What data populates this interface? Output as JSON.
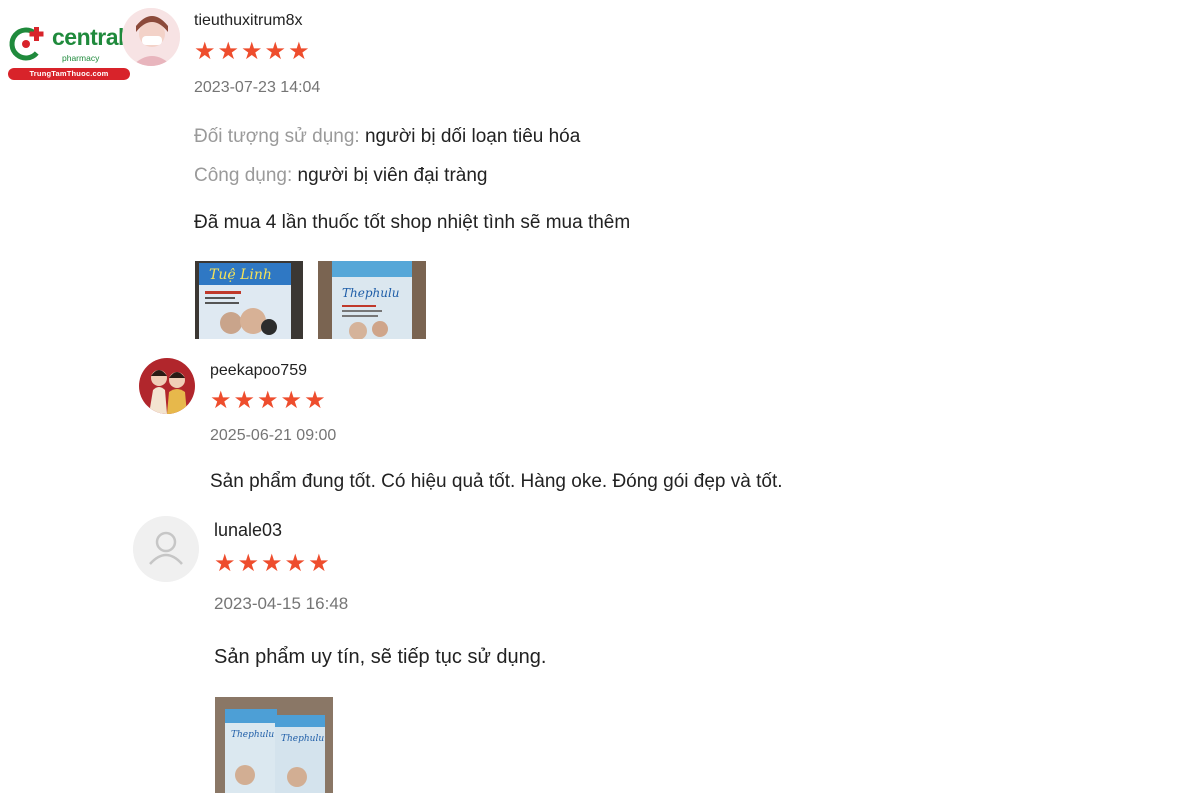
{
  "brand": {
    "name": "central",
    "tagline": "pharmacy",
    "site": "TrungTamThuoc.com",
    "colors": {
      "green": "#1f8a3c",
      "red": "#d8232a"
    }
  },
  "star_color": "#ee4d2d",
  "reviews": [
    {
      "username": "tieuthuxitrum8x",
      "rating": 5,
      "date": "2023-07-23 14:04",
      "attributes": [
        {
          "label": "Đối tượng sử dụng:",
          "value": "người bị dối loạn tiêu hóa"
        },
        {
          "label": "Công dụng:",
          "value": "người bị viên đại tràng"
        }
      ],
      "comment": "Đã mua 4 lần thuốc tốt shop nhiệt tình sẽ mua thêm",
      "photos": [
        "product-photo",
        "product-photo"
      ]
    },
    {
      "username": "peekapoo759",
      "rating": 5,
      "date": "2025-06-21 09:00",
      "comment": "Sản phẩm đung tốt. Có hiệu quả tốt. Hàng oke. Đóng gói đẹp và tốt.",
      "photos": []
    },
    {
      "username": "lunale03",
      "rating": 5,
      "date": "2023-04-15 16:48",
      "comment": "Sản phẩm uy tín, sẽ tiếp tục sử dụng.",
      "photos": [
        "product-photo"
      ]
    }
  ],
  "product_photo_text": {
    "brand_line": "Thephulu",
    "script_title": "Tuệ Linh"
  }
}
